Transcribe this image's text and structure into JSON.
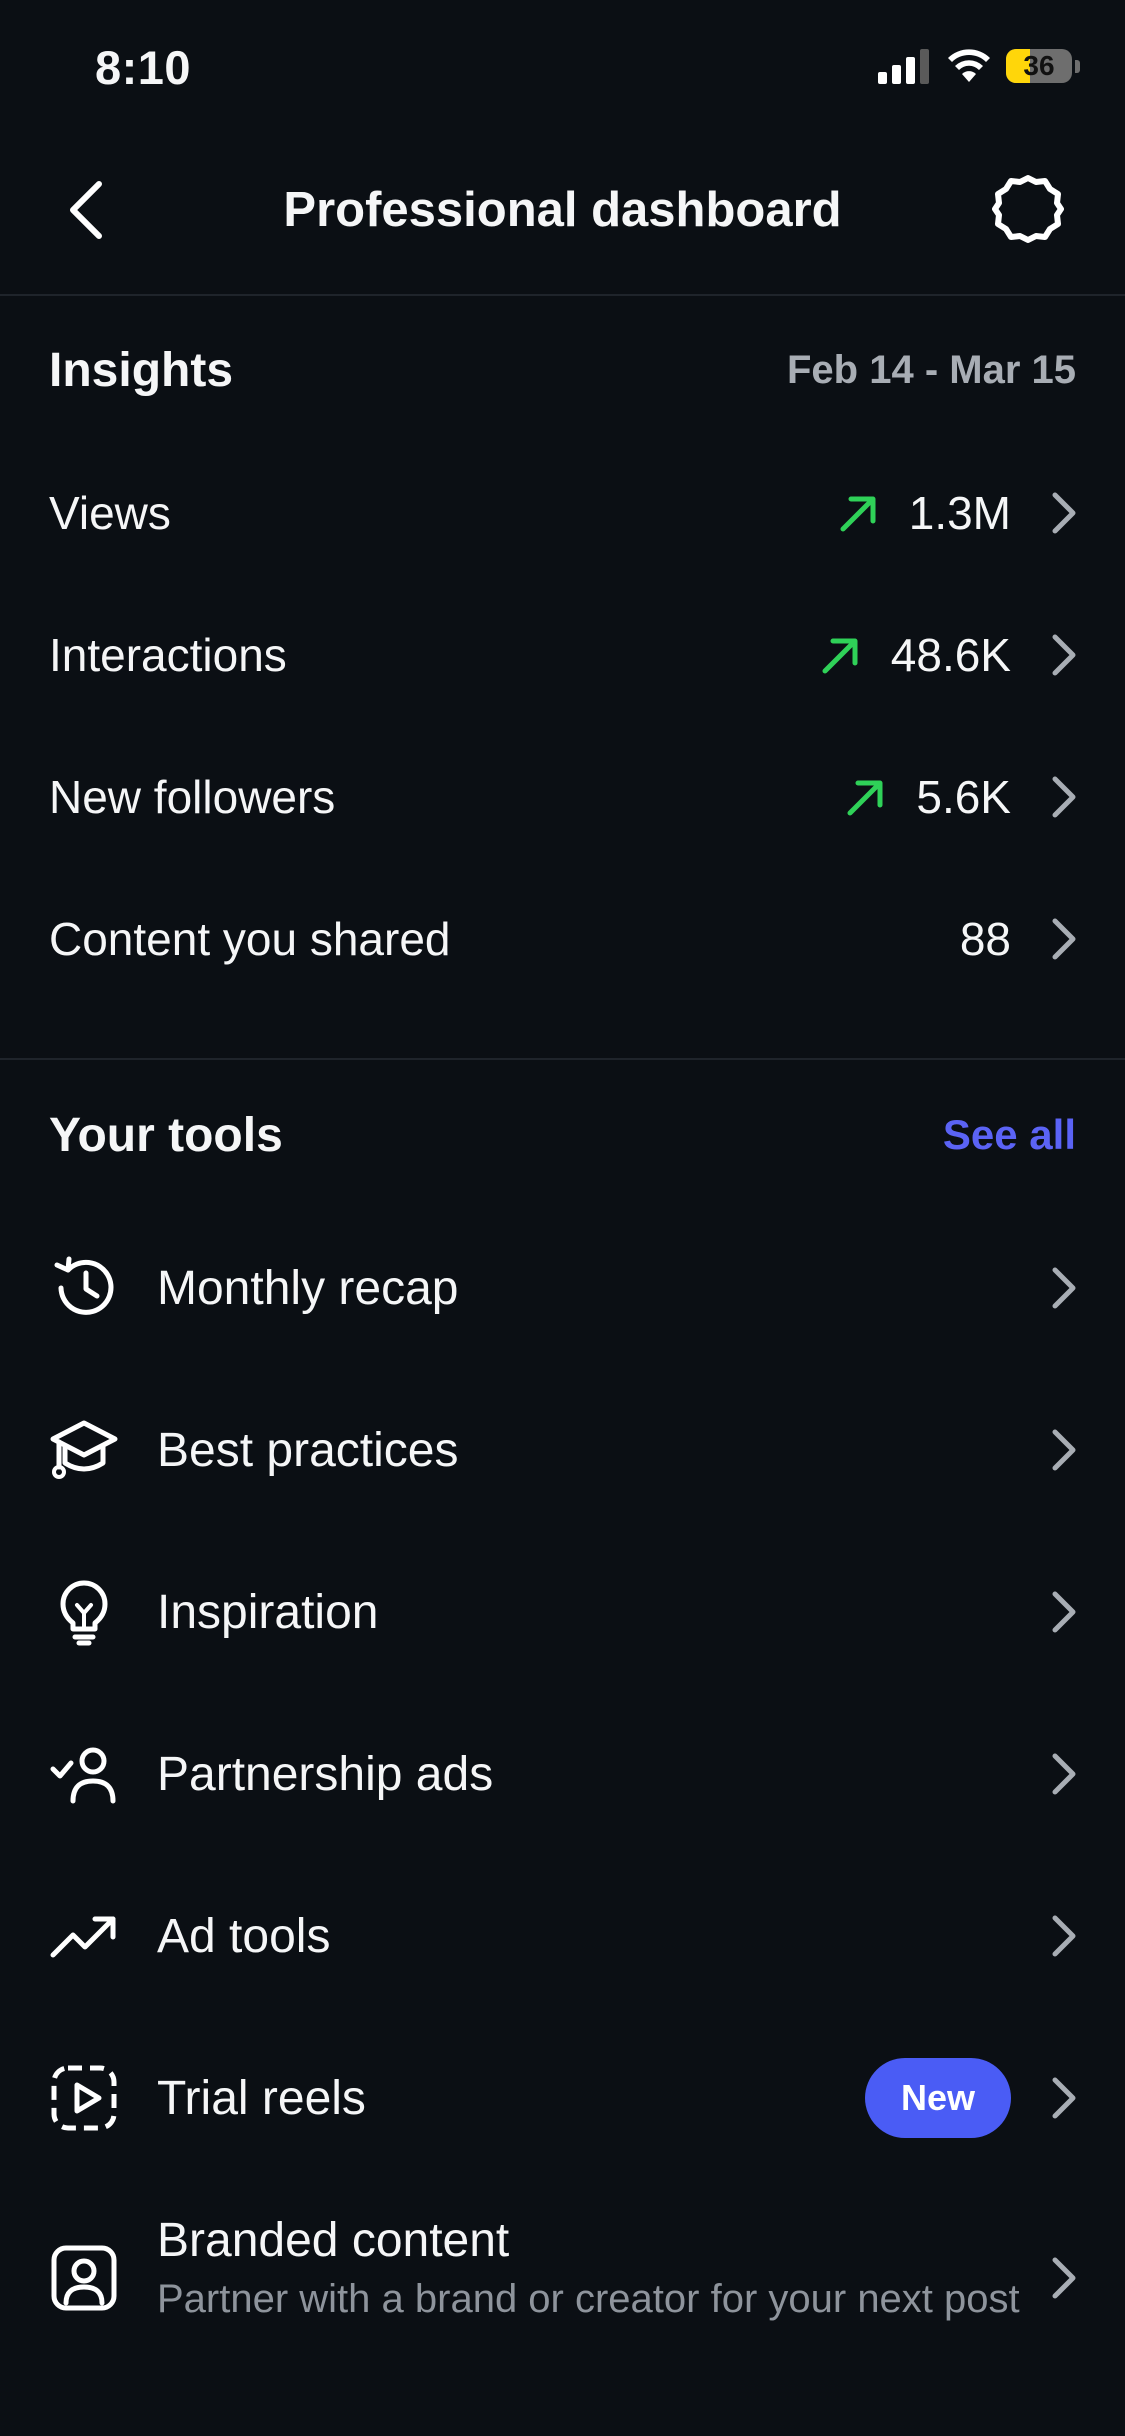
{
  "status_bar": {
    "time": "8:10",
    "battery": "36",
    "battery_level_percent": 36,
    "battery_color": "#ffd60a"
  },
  "header": {
    "title": "Professional dashboard",
    "back_icon": "chevron-left-icon",
    "settings_icon": "gear-icon"
  },
  "insights": {
    "title": "Insights",
    "date_range": "Feb 14 - Mar 15",
    "trend_color": "#2fd158",
    "metrics": [
      {
        "label": "Views",
        "value": "1.3M",
        "trend": "up"
      },
      {
        "label": "Interactions",
        "value": "48.6K",
        "trend": "up"
      },
      {
        "label": "New followers",
        "value": "5.6K",
        "trend": "up"
      },
      {
        "label": "Content you shared",
        "value": "88",
        "trend": "none"
      }
    ]
  },
  "tools": {
    "title": "Your tools",
    "see_all": "See all",
    "accent_color": "#5b63f5",
    "items": [
      {
        "label": "Monthly recap",
        "icon": "history-clock-icon"
      },
      {
        "label": "Best practices",
        "icon": "graduation-cap-icon"
      },
      {
        "label": "Inspiration",
        "icon": "lightbulb-icon"
      },
      {
        "label": "Partnership ads",
        "icon": "person-check-icon"
      },
      {
        "label": "Ad tools",
        "icon": "trending-up-icon"
      },
      {
        "label": "Trial reels",
        "icon": "reel-play-icon",
        "badge": "New"
      },
      {
        "label": "Branded content",
        "subtitle": "Partner with a brand or creator for your next post",
        "icon": "portrait-icon"
      }
    ]
  }
}
